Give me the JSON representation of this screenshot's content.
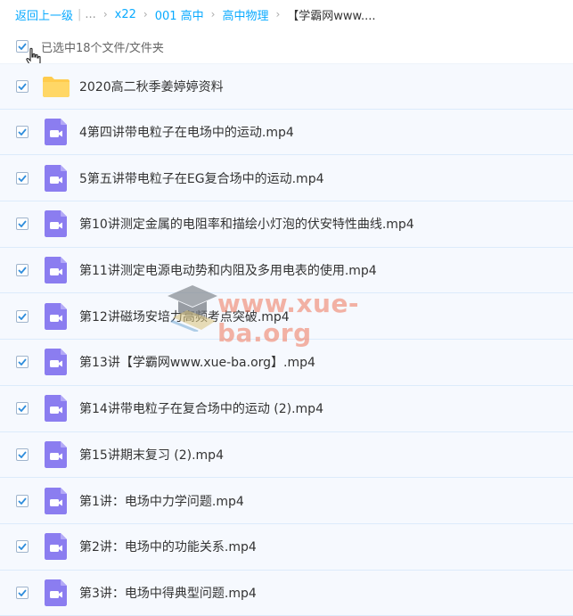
{
  "breadcrumb": {
    "back": "返回上一级",
    "ellipsis": "...",
    "crumbs": [
      "x22",
      "001 高中",
      "高中物理"
    ],
    "current": "【学霸网www...."
  },
  "selection": {
    "label": "已选中18个文件/文件夹"
  },
  "files": [
    {
      "type": "folder",
      "name": "2020高二秋季姜婷婷资料"
    },
    {
      "type": "video",
      "name": "4第四讲带电粒子在电场中的运动.mp4"
    },
    {
      "type": "video",
      "name": "5第五讲带电粒子在EG复合场中的运动.mp4"
    },
    {
      "type": "video",
      "name": "第10讲测定金属的电阻率和描绘小灯泡的伏安特性曲线.mp4"
    },
    {
      "type": "video",
      "name": "第11讲测定电源电动势和内阻及多用电表的使用.mp4"
    },
    {
      "type": "video",
      "name": "第12讲磁场安培力高频考点突破.mp4"
    },
    {
      "type": "video",
      "name": "第13讲【学霸网www.xue-ba.org】.mp4"
    },
    {
      "type": "video",
      "name": "第14讲带电粒子在复合场中的运动 (2).mp4"
    },
    {
      "type": "video",
      "name": "第15讲期末复习 (2).mp4"
    },
    {
      "type": "video",
      "name": "第1讲：电场中力学问题.mp4"
    },
    {
      "type": "video",
      "name": "第2讲：电场中的功能关系.mp4"
    },
    {
      "type": "video",
      "name": "第3讲：电场中得典型问题.mp4"
    }
  ],
  "watermark": {
    "text": "www.xue-ba.org"
  },
  "colors": {
    "link": "#09aaff",
    "check": "#2f8ddc",
    "folder": "#ffcc4d",
    "video": "#8b7df0",
    "row_bg": "#f6f9fe"
  }
}
